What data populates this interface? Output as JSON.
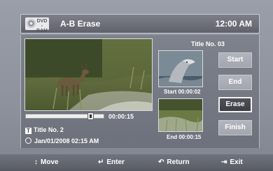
{
  "header": {
    "disc_line1": "DVD",
    "disc_line2": "-RAM",
    "title": "A-B Erase",
    "clock": "12:00 AM"
  },
  "player": {
    "progress_fraction": 0.83,
    "elapsed_time": "00:00:15",
    "title_badge": "T",
    "title_label": "Title No. 2",
    "datetime": "Jan/01/2008 02:15 AM"
  },
  "segment": {
    "title_label": "Title No. 03",
    "start_label": "Start 00:00:02",
    "end_label": "End 00:00:15"
  },
  "buttons": [
    {
      "label": "Start",
      "selected": false
    },
    {
      "label": "End",
      "selected": false
    },
    {
      "label": "Erase",
      "selected": true
    },
    {
      "label": "Finish",
      "selected": false
    }
  ],
  "footer": {
    "move_icon": "↕",
    "move_label": "Move",
    "enter_icon": "↵",
    "enter_label": "Enter",
    "return_icon": "↶",
    "return_label": "Return",
    "exit_icon": "⇥",
    "exit_label": "Exit"
  },
  "colors": {
    "background": "#8e929d",
    "button_selected": "#45474e",
    "button_normal": "#aaadb5"
  }
}
